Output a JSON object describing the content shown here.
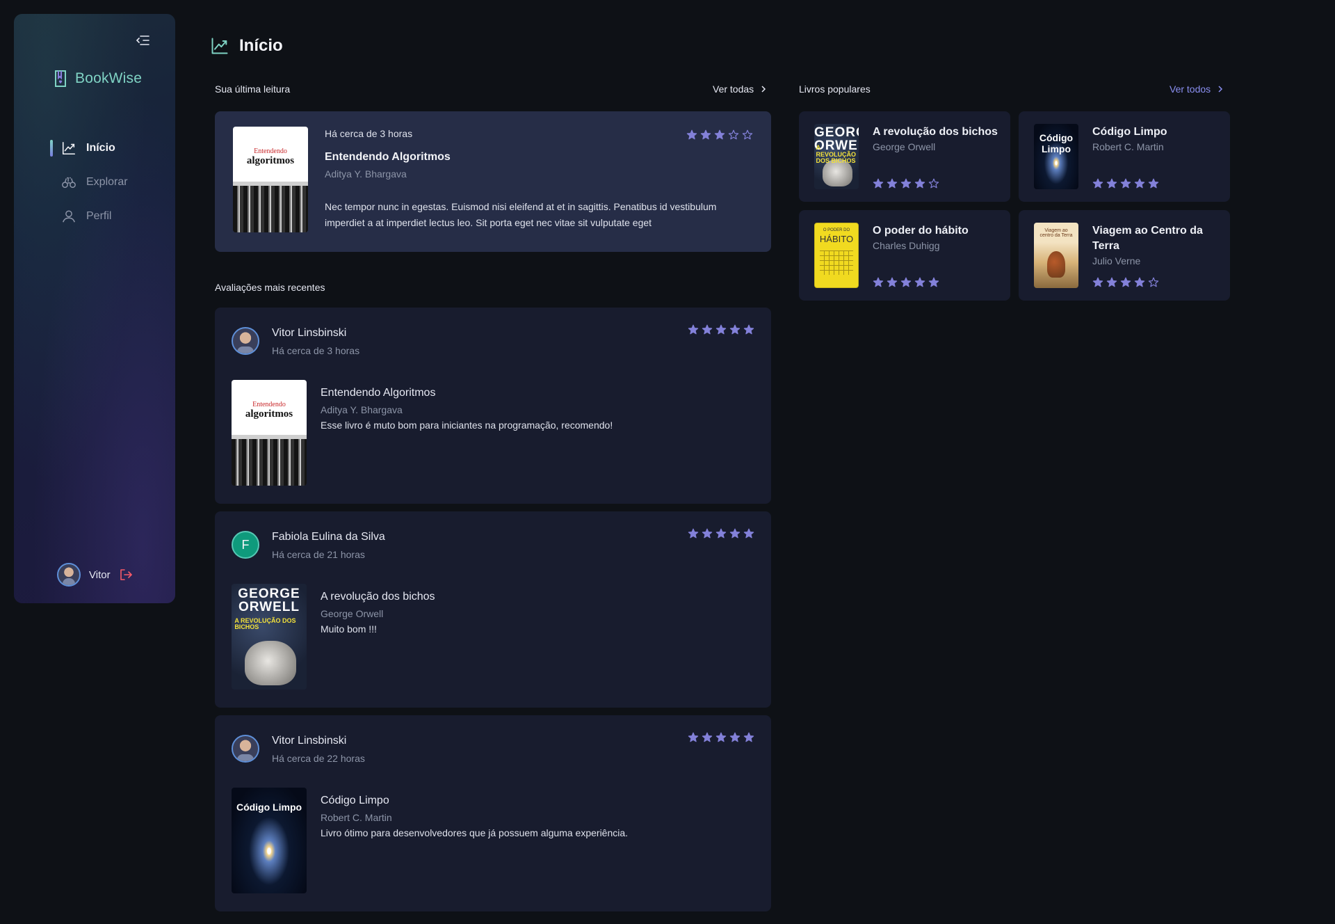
{
  "app": {
    "name": "BookWise"
  },
  "nav": [
    {
      "label": "Início",
      "icon": "chart-line-icon",
      "active": true
    },
    {
      "label": "Explorar",
      "icon": "binoculars-icon",
      "active": false
    },
    {
      "label": "Perfil",
      "icon": "user-icon",
      "active": false
    }
  ],
  "user": {
    "name": "Vitor"
  },
  "page": {
    "title": "Início"
  },
  "last_reading": {
    "section_label": "Sua última leitura",
    "see_all": "Ver todas",
    "time": "Há cerca de 3 horas",
    "title": "Entendendo Algoritmos",
    "author": "Aditya Y. Bhargava",
    "rating": 3,
    "description": "Nec tempor nunc in egestas. Euismod nisi eleifend at et in sagittis. Penatibus id vestibulum imperdiet a at imperdiet lectus leo. Sit porta eget nec vitae sit vulputate eget"
  },
  "recent": {
    "section_label": "Avaliações mais recentes",
    "items": [
      {
        "user": "Vitor Linsbinski",
        "time": "Há cerca de 3 horas",
        "rating": 5,
        "book": "Entendendo Algoritmos",
        "author": "Aditya Y. Bhargava",
        "text": "Esse livro é muto bom para iniciantes na programação, recomendo!",
        "avatar_initial": ""
      },
      {
        "user": "Fabiola Eulina da Silva",
        "time": "Há cerca de 21 horas",
        "rating": 5,
        "book": "A revolução dos bichos",
        "author": "George Orwell",
        "text": "Muito bom !!!",
        "avatar_initial": "F"
      },
      {
        "user": "Vitor Linsbinski",
        "time": "Há cerca de 22 horas",
        "rating": 5,
        "book": "Código Limpo",
        "author": "Robert C. Martin",
        "text": "Livro ótimo para desenvolvedores que já possuem alguma experiência.",
        "avatar_initial": ""
      }
    ]
  },
  "popular": {
    "section_label": "Livros populares",
    "see_all": "Ver todos",
    "items": [
      {
        "title": "A revolução dos bichos",
        "author": "George Orwell",
        "rating": 4
      },
      {
        "title": "Código Limpo",
        "author": "Robert C. Martin",
        "rating": 5
      },
      {
        "title": "O poder do hábito",
        "author": "Charles Duhigg",
        "rating": 5
      },
      {
        "title": "Viagem ao Centro da Terra",
        "author": "Julio Verne",
        "rating": 4
      }
    ]
  },
  "covers": {
    "algoritmos": {
      "line1": "Entendendo",
      "line2": "algoritmos"
    },
    "orwell": {
      "line1": "GEORGE",
      "line2": "ORWELL",
      "line3": "A REVOLUÇÃO DOS BICHOS"
    },
    "codigo": {
      "line1": "Código Limpo"
    },
    "habito": {
      "line1": "O PODER DO",
      "line2": "HÁBITO"
    },
    "viagem": {
      "line1": "Viagem ao centro da Terra"
    }
  },
  "colors": {
    "accent": "#7a7fe0",
    "teal": "#7fd3c4",
    "logout": "#f75a68"
  }
}
